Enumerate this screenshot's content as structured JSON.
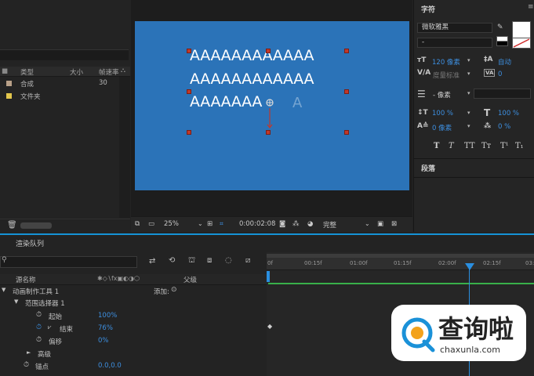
{
  "project": {
    "columns": [
      "类型",
      "大小",
      "帧速率"
    ],
    "items": [
      {
        "name": "合成",
        "fps": "30",
        "color": "#b8a088"
      },
      {
        "name": "文件夹",
        "fps": "",
        "color": "#e2c64c"
      }
    ]
  },
  "composition": {
    "background": "#2b73b8",
    "text_lines": [
      "AAAAAAAAAAAA",
      "AAAAAAAAAAAA",
      "AAAAAAA"
    ]
  },
  "viewer_bar": {
    "zoom": "25%",
    "timecode": "0:00:02:08",
    "quality": "完整"
  },
  "character_panel": {
    "title": "字符",
    "font_family": "微软雅黑",
    "font_style": "-",
    "font_size": "120 像素",
    "leading": "自动",
    "kerning": "度量标准",
    "tracking": "0",
    "stroke_width": "- 像素",
    "vertical_scale": "100 %",
    "horizontal_scale": "100 %",
    "baseline_shift": "0 像素",
    "tsume": "0 %",
    "text_styles": [
      "T",
      "T",
      "TT",
      "Tт",
      "T¹",
      "T₁"
    ],
    "paragraph_title": "段落"
  },
  "render_queue": {
    "label": "渲染队列"
  },
  "timeline": {
    "header": {
      "source_name": "源名称",
      "parent": "父级"
    },
    "add_label": "添加:",
    "rows": [
      {
        "label": "动画制作工具 1",
        "value": ""
      },
      {
        "label": "范围选择器 1",
        "value": ""
      },
      {
        "label": "起始",
        "value": "100%"
      },
      {
        "label": "结束",
        "value": "76%"
      },
      {
        "label": "偏移",
        "value": "0%"
      },
      {
        "label": "高级",
        "value": ""
      },
      {
        "label": "锚点",
        "value": "0.0,0.0"
      }
    ],
    "ruler": [
      "0f",
      "00:15f",
      "01:00f",
      "01:15f",
      "02:00f",
      "02:15f",
      "03:0"
    ]
  },
  "watermark": {
    "brand": "查询啦",
    "url": "chaxunla.com"
  }
}
